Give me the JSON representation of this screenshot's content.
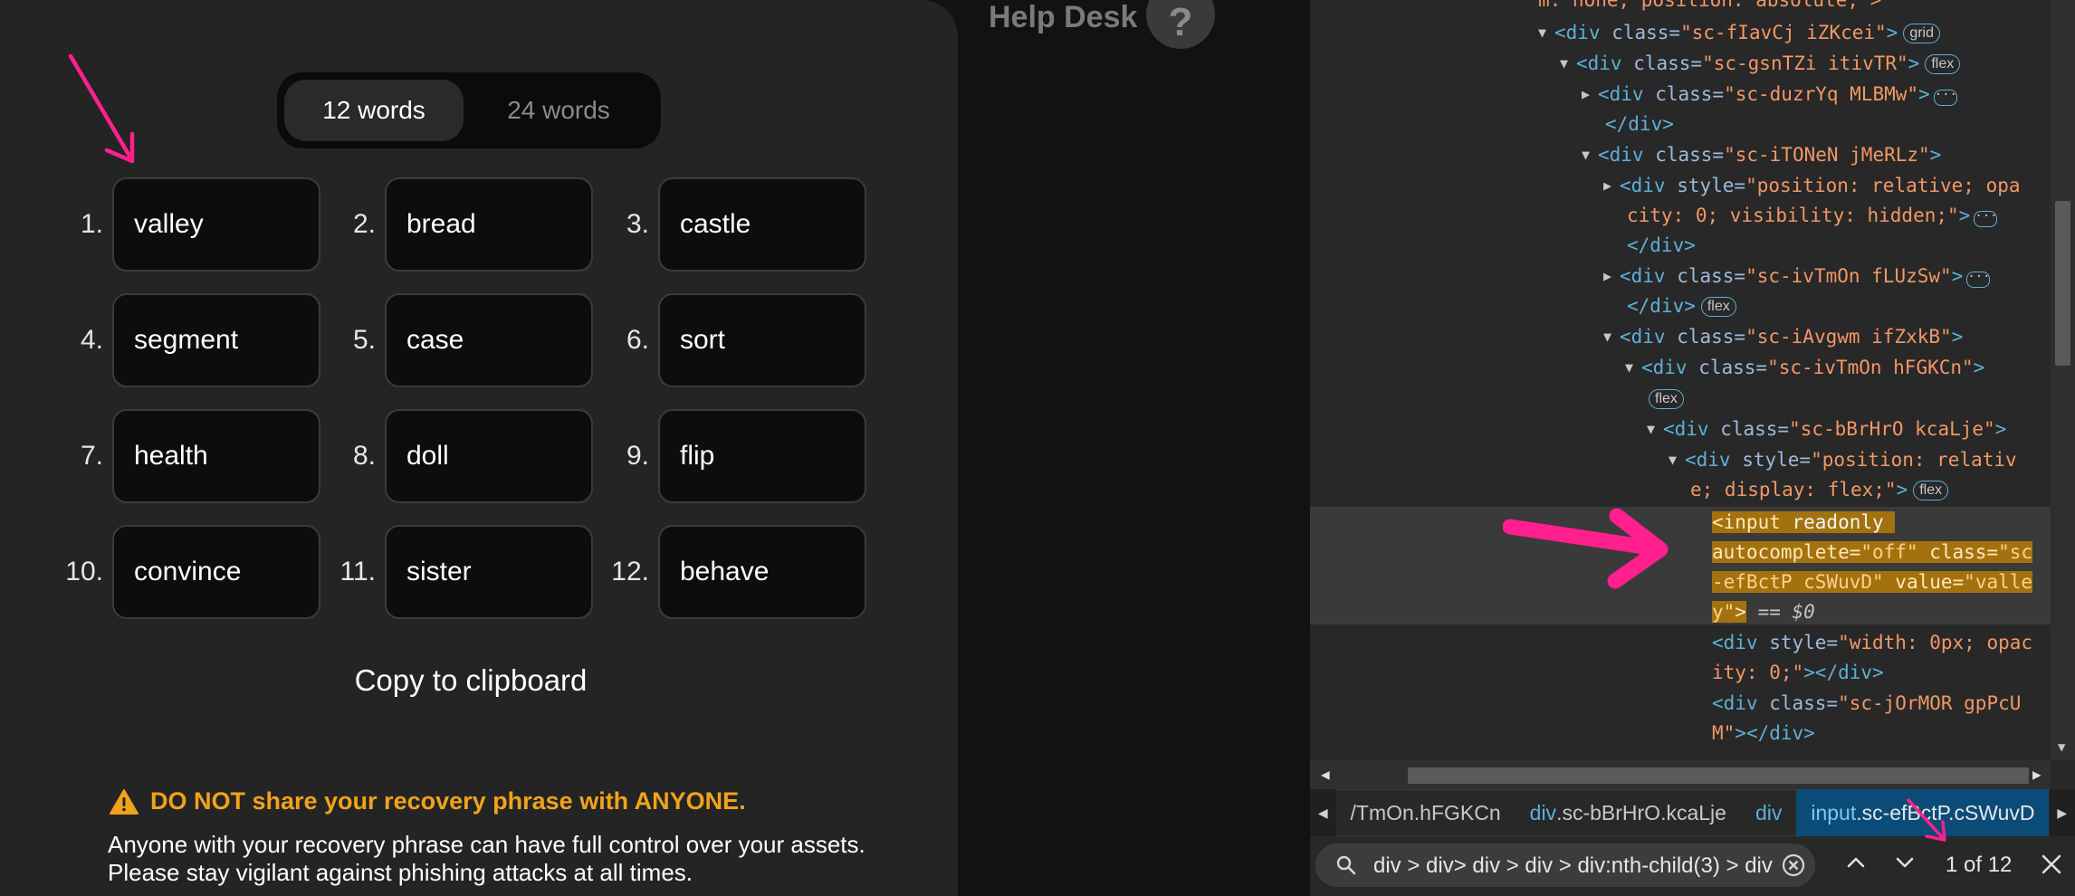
{
  "wallet": {
    "toggle": {
      "twelve": "12 words",
      "twentyfour": "24 words"
    },
    "words": [
      {
        "num": "1.",
        "word": "valley"
      },
      {
        "num": "2.",
        "word": "bread"
      },
      {
        "num": "3.",
        "word": "castle"
      },
      {
        "num": "4.",
        "word": "segment"
      },
      {
        "num": "5.",
        "word": "case"
      },
      {
        "num": "6.",
        "word": "sort"
      },
      {
        "num": "7.",
        "word": "health"
      },
      {
        "num": "8.",
        "word": "doll"
      },
      {
        "num": "9.",
        "word": "flip"
      },
      {
        "num": "10.",
        "word": "convince"
      },
      {
        "num": "11.",
        "word": "sister"
      },
      {
        "num": "12.",
        "word": "behave"
      }
    ],
    "copy_label": "Copy to clipboard",
    "warning_title": "DO NOT share your recovery phrase with ANYONE.",
    "warning_body": "Anyone with your recovery phrase can have full control over your assets. Please stay vigilant against phishing attacks at all times.",
    "warning_color": "#f0a31a"
  },
  "help": {
    "label": "Help Desk",
    "icon": "?"
  },
  "devtools": {
    "top_cut": "m: none; position: absolute; >",
    "l1": {
      "tag": "<div",
      "attr": " class=",
      "val": "\"sc-fIavCj iZKcei\"",
      "end": ">",
      "badge": "grid"
    },
    "l2": {
      "tag": "<div",
      "attr": " class=",
      "val": "\"sc-gsnTZi itivTR\"",
      "end": ">",
      "badge": "flex"
    },
    "l3": {
      "tag": "<div",
      "attr": " class=",
      "val": "\"sc-duzrYq MLBMw\"",
      "end": ">"
    },
    "l3c": "</div>",
    "l4": {
      "tag": "<div",
      "attr": " class=",
      "val": "\"sc-iTONeN jMeRLz\"",
      "end": ">"
    },
    "l5": {
      "tag": "<div",
      "attr": " style=",
      "val": "\"position: relative; opa"
    },
    "l5b": {
      "val": "city: 0; visibility: hidden;\"",
      "end": ">"
    },
    "l5c": "</div>",
    "l6": {
      "tag": "<div",
      "attr": " class=",
      "val": "\"sc-ivTmOn fLUzSw\"",
      "end": ">"
    },
    "l6c": "</div>",
    "l6badge": "flex",
    "l7": {
      "tag": "<div",
      "attr": " class=",
      "val": "\"sc-iAvgwm ifZxkB\"",
      "end": ">"
    },
    "l8": {
      "tag": "<div",
      "attr": " class=",
      "val": "\"sc-ivTmOn hFGKCn\"",
      "end": ">"
    },
    "l8badge": "flex",
    "l9": {
      "tag": "<div",
      "attr": " class=",
      "val": "\"sc-bBrHrO kcaLje\"",
      "end": ">"
    },
    "l10": {
      "tag": "<div",
      "attr": " style=",
      "val": "\"position: relativ"
    },
    "l10b": {
      "val": "e; display: flex;\"",
      "end": ">",
      "badge": "flex"
    },
    "sel1": {
      "tag": "<input",
      "attr": " readonly"
    },
    "sel2": {
      "attr": "autocomplete=",
      "val": "\"off\"",
      "attr2": " class=",
      "val2": "\"sc"
    },
    "sel3": {
      "val": "-efBctP cSWuvD\"",
      "attr": " value=",
      "val2": "\"valle"
    },
    "sel4": {
      "val": "y\"",
      "end": ">",
      "eq": " == $0"
    },
    "l11": {
      "tag": "<div",
      "attr": " style=",
      "val": "\"width: 0px; opac"
    },
    "l11b": {
      "val": "ity: 0;\"",
      "end": "></div>"
    },
    "l12": {
      "tag": "<div",
      "attr": " class=",
      "val": "\"sc-jOrMOR gpPcU"
    },
    "l12b": {
      "val": "M\"",
      "end": "></div>"
    },
    "crumbs": [
      {
        "tag": "",
        "cls": "/TmOn.hFGKCn"
      },
      {
        "tag": "div",
        "cls": ".sc-bBrHrO.kcaLje"
      },
      {
        "tag": "div",
        "cls": ""
      },
      {
        "tag": "input",
        "cls": ".sc-efBctP.cSWuvD"
      }
    ],
    "search_query": "div > div> div > div > div:nth-child(3) > div",
    "match_count": "1 of 12"
  },
  "icons": {
    "warning": "warning-triangle-icon",
    "search": "search-icon",
    "clear": "clear-circle-icon",
    "up": "chevron-up-icon",
    "down": "chevron-down-icon",
    "close": "close-icon"
  }
}
